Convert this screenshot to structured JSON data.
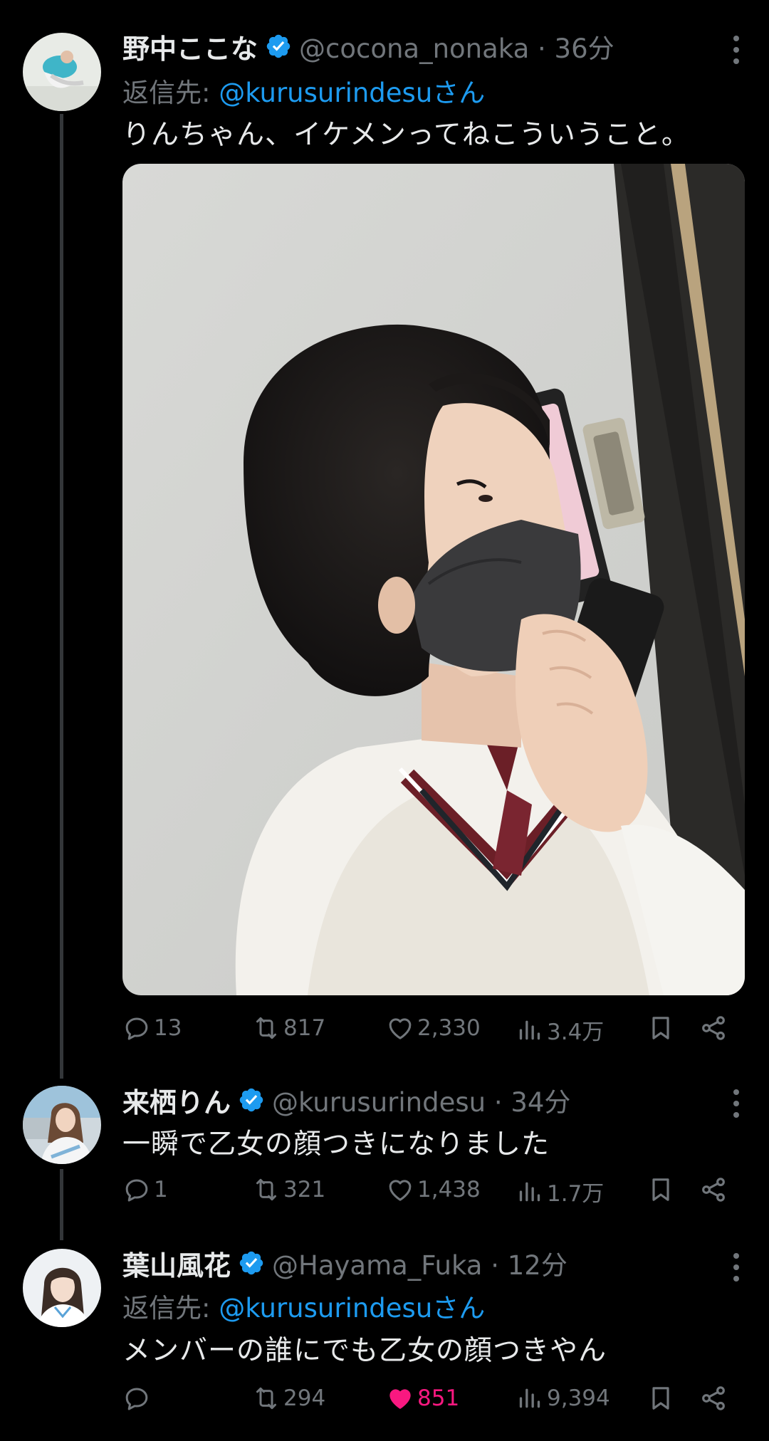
{
  "tweets": [
    {
      "name": "野中ここな",
      "handle": "@cocona_nonaka · 36分",
      "reply_label": "返信先:",
      "reply_mention": "@kurusurindesuさん",
      "text": "りんちゃん、イケメンってねこういうこと。",
      "stats": {
        "replies": "13",
        "retweets": "817",
        "likes": "2,330",
        "views": "3.4万"
      },
      "liked": false
    },
    {
      "name": "来栖りん",
      "handle": "@kurusurindesu · 34分",
      "text": "一瞬で乙女の顔つきになりました",
      "stats": {
        "replies": "1",
        "retweets": "321",
        "likes": "1,438",
        "views": "1.7万"
      },
      "liked": false
    },
    {
      "name": "葉山風花",
      "handle": "@Hayama_Fuka · 12分",
      "reply_label": "返信先:",
      "reply_mention": "@kurusurindesuさん",
      "text": "メンバーの誰にでも乙女の顔つきやん",
      "stats": {
        "replies": "",
        "retweets": "294",
        "likes": "851",
        "views": "9,394"
      },
      "liked": true
    }
  ],
  "colors": {
    "accent": "#1d9bf0",
    "like": "#f91880",
    "muted": "#71767b",
    "text": "#e7e9ea"
  },
  "icons": [
    "verified-badge-icon",
    "more-icon",
    "reply-icon",
    "retweet-icon",
    "like-icon",
    "views-icon",
    "bookmark-icon",
    "share-icon"
  ]
}
